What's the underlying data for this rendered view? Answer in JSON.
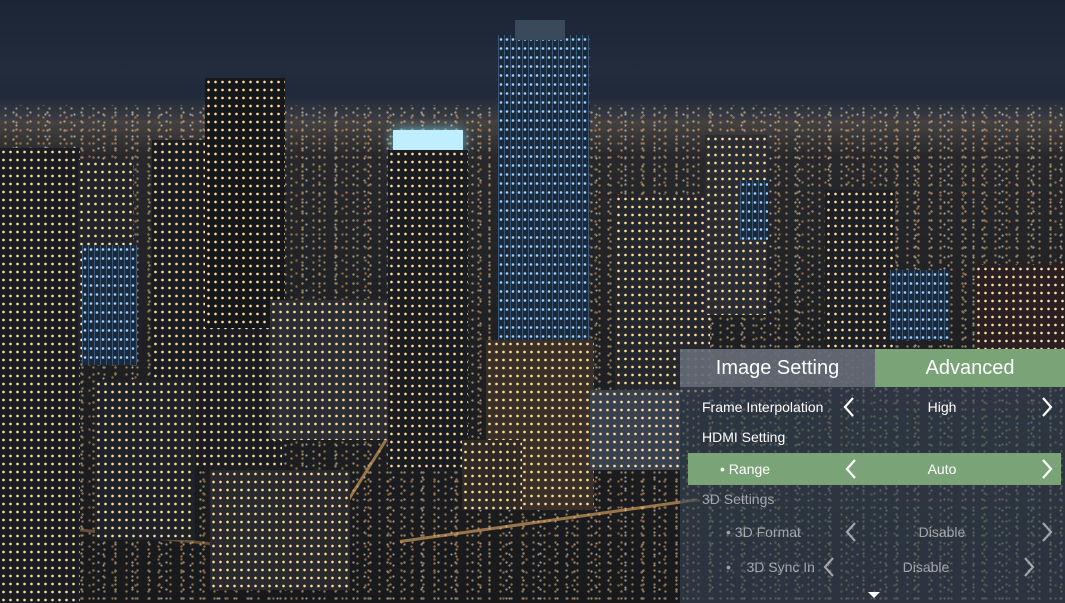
{
  "menu": {
    "tabs": [
      {
        "label": "Image Setting",
        "active": false
      },
      {
        "label": "Advanced",
        "active": true
      }
    ],
    "frame_interpolation": {
      "label": "Frame Interpolation",
      "value": "High"
    },
    "hdmi_setting": {
      "label": "HDMI Setting"
    },
    "range": {
      "label": "• Range",
      "value": "Auto"
    },
    "settings_3d": {
      "label": "3D Settings"
    },
    "format_3d": {
      "label": "• 3D Format",
      "value": "Disable"
    },
    "sync_3d": {
      "label": "•    3D Sync In",
      "value": "Disable"
    }
  },
  "icons": {
    "left": "chevron-left-icon",
    "right": "chevron-right-icon",
    "more": "caret-down-icon"
  },
  "colors": {
    "accent": "#7aa377",
    "tab_inactive": "#6e737d",
    "panel": "rgba(55,70,85,0.62)"
  }
}
